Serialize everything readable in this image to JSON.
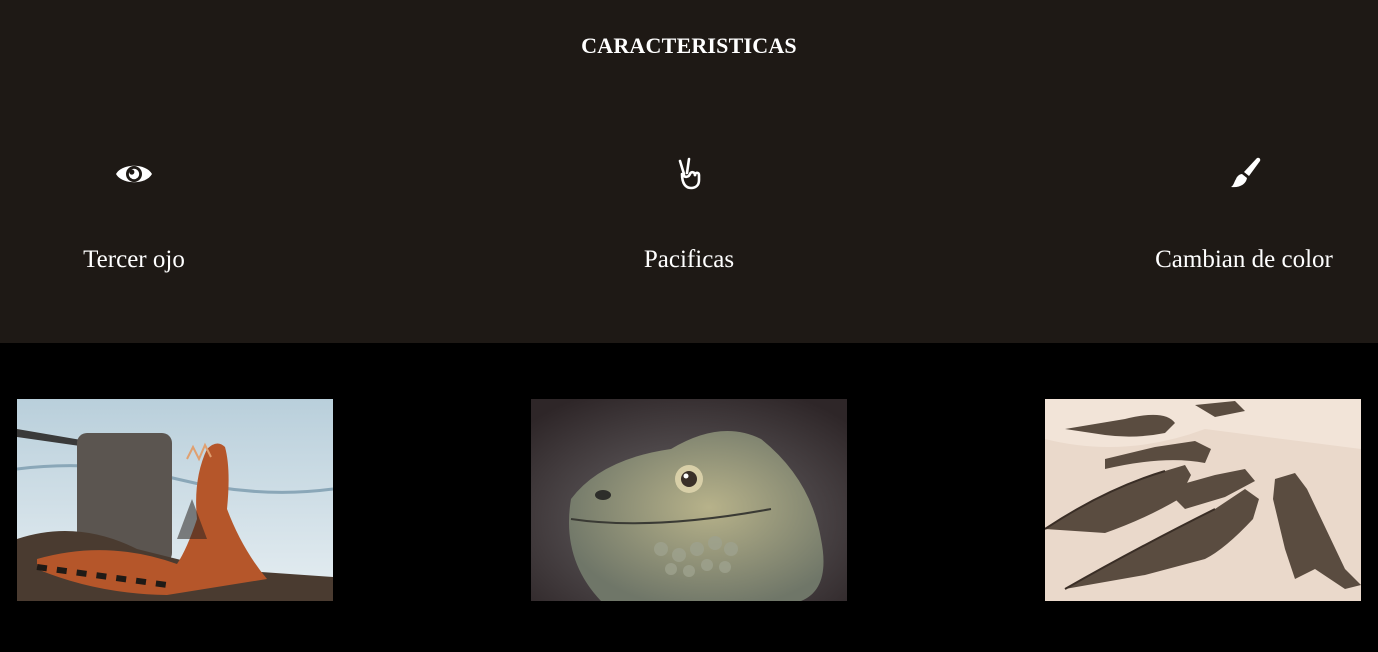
{
  "features": {
    "title": "CARACTERISTICAS",
    "background": "#1e1915",
    "items": [
      {
        "icon": "eye-icon",
        "label": "Tercer ojo"
      },
      {
        "icon": "peace-hand-icon",
        "label": "Pacificas"
      },
      {
        "icon": "paint-brush-icon",
        "label": "Cambian de color"
      }
    ]
  },
  "gallery": {
    "background": "#000000",
    "images": [
      {
        "subject": "iguana-on-rocks-by-water"
      },
      {
        "subject": "iguana-head-closeup"
      },
      {
        "subject": "group-of-iguanas-on-sand"
      }
    ]
  }
}
